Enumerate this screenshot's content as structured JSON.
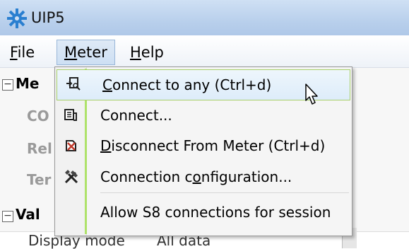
{
  "window": {
    "title": "UIP5",
    "icon": "app-gear-icon"
  },
  "menubar": {
    "file": {
      "pre": "",
      "ul": "F",
      "post": "ile"
    },
    "meter": {
      "pre": "",
      "ul": "M",
      "post": "eter"
    },
    "help": {
      "pre": "",
      "ul": "H",
      "post": "elp"
    }
  },
  "panel": {
    "group1_label": "Me",
    "row1": "CO",
    "row2": "Rel",
    "row3": "Ter",
    "group2_label": "Val",
    "bottom_label": "Display mode",
    "bottom_value": "All data"
  },
  "dropdown": {
    "items": [
      {
        "pre": "",
        "ul": "C",
        "post": "onnect to any (Ctrl+d)",
        "icon": "connect-any-icon"
      },
      {
        "pre": "Connect...",
        "ul": "",
        "post": "",
        "icon": "connect-icon"
      },
      {
        "pre": "",
        "ul": "D",
        "post": "isconnect From Meter (Ctrl+d)",
        "icon": "disconnect-icon"
      },
      {
        "pre": "Connection c",
        "ul": "o",
        "post": "nfiguration...",
        "icon": "tools-icon"
      },
      {
        "pre": "Allow S8 connections for session",
        "ul": "",
        "post": "",
        "icon": ""
      }
    ]
  },
  "colors": {
    "highlight_border": "#a8d06a",
    "gutter_stripe": "#aee26a"
  }
}
